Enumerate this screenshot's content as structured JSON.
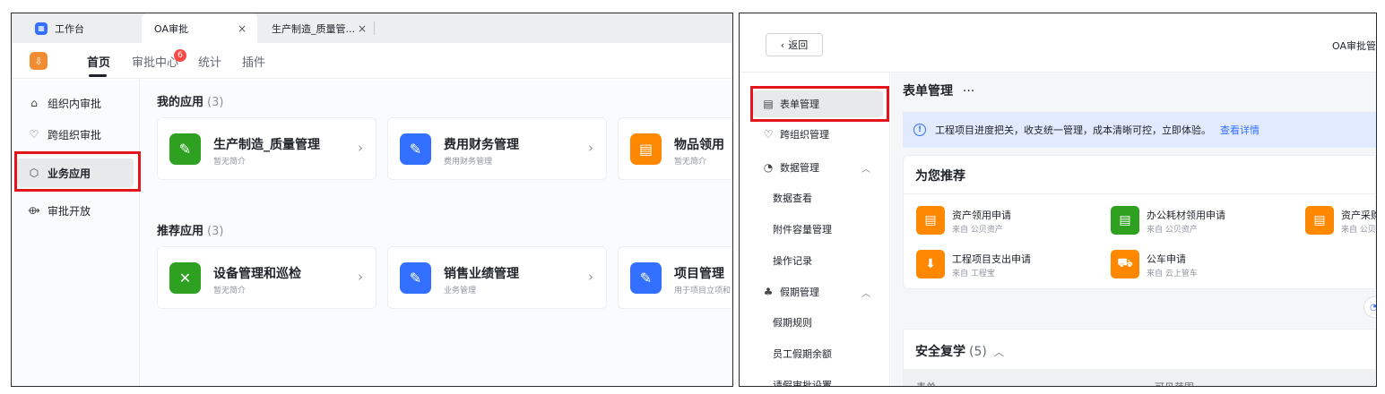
{
  "left": {
    "tabs": [
      {
        "label": "工作台"
      },
      {
        "label": "OA审批",
        "close": "×"
      },
      {
        "label": "生产制造_质量管...",
        "close": "×"
      }
    ],
    "nav": {
      "home": "首页",
      "center": "审批中心",
      "center_badge": "6",
      "stats": "统计",
      "plugins": "插件"
    },
    "sidebar": [
      {
        "label": "组织内审批",
        "icon": "home-icon"
      },
      {
        "label": "跨组织审批",
        "icon": "handshake-icon"
      },
      {
        "label": "业务应用",
        "icon": "cube-icon",
        "selected": true
      },
      {
        "label": "审批开放",
        "icon": "share-icon"
      }
    ],
    "my_apps": {
      "title": "我的应用",
      "count": "(3)",
      "cards": [
        {
          "title": "生产制造_质量管理",
          "sub": "暂无简介",
          "color": "#2ea121"
        },
        {
          "title": "费用财务管理",
          "sub": "费用财务管理",
          "color": "#3370ff"
        },
        {
          "title": "物品领用",
          "sub": "暂无简介",
          "color": "#ff8800"
        }
      ]
    },
    "rec_apps": {
      "title": "推荐应用",
      "count": "(3)",
      "cards": [
        {
          "title": "设备管理和巡检",
          "sub": "暂无简介",
          "color": "#2ea121"
        },
        {
          "title": "销售业绩管理",
          "sub": "业务管理",
          "color": "#3370ff"
        },
        {
          "title": "项目管理",
          "sub": "用于项目立项和",
          "color": "#3370ff"
        }
      ]
    },
    "arrow": "›"
  },
  "right": {
    "back": "返回",
    "top_title": "OA审批管",
    "sidebar": {
      "form_mgmt": "表单管理",
      "cross_org": "跨组织管理",
      "data_mgmt": "数据管理",
      "data_view": "数据查看",
      "attach": "附件容量管理",
      "oplog": "操作记录",
      "holiday": "假期管理",
      "holiday_rules": "假期规则",
      "balance": "员工假期余额",
      "leave_settings": "请假审批设置"
    },
    "page_title": "表单管理",
    "more": "···",
    "info": {
      "text": "工程项目进度把关，收支统一管理，成本清晰可控，立即体验。",
      "link": "查看详情"
    },
    "rec_title": "为您推荐",
    "rec_items": [
      {
        "title": "资产领用申请",
        "sub": "来自 公贝资产",
        "color": "#ff8800"
      },
      {
        "title": "办公耗材领用申请",
        "sub": "来自 公贝资产",
        "color": "#2ea121"
      },
      {
        "title": "资产采购",
        "sub": "来自 公贝",
        "color": "#ff8800"
      },
      {
        "title": "工程项目支出申请",
        "sub": "来自 工程宝",
        "color": "#ff8800"
      },
      {
        "title": "公车申请",
        "sub": "来自 云上管车",
        "color": "#ff8800"
      }
    ],
    "safety": {
      "title": "安全复学",
      "count": "(5)",
      "col1": "表单",
      "col2": "可见范围"
    }
  }
}
